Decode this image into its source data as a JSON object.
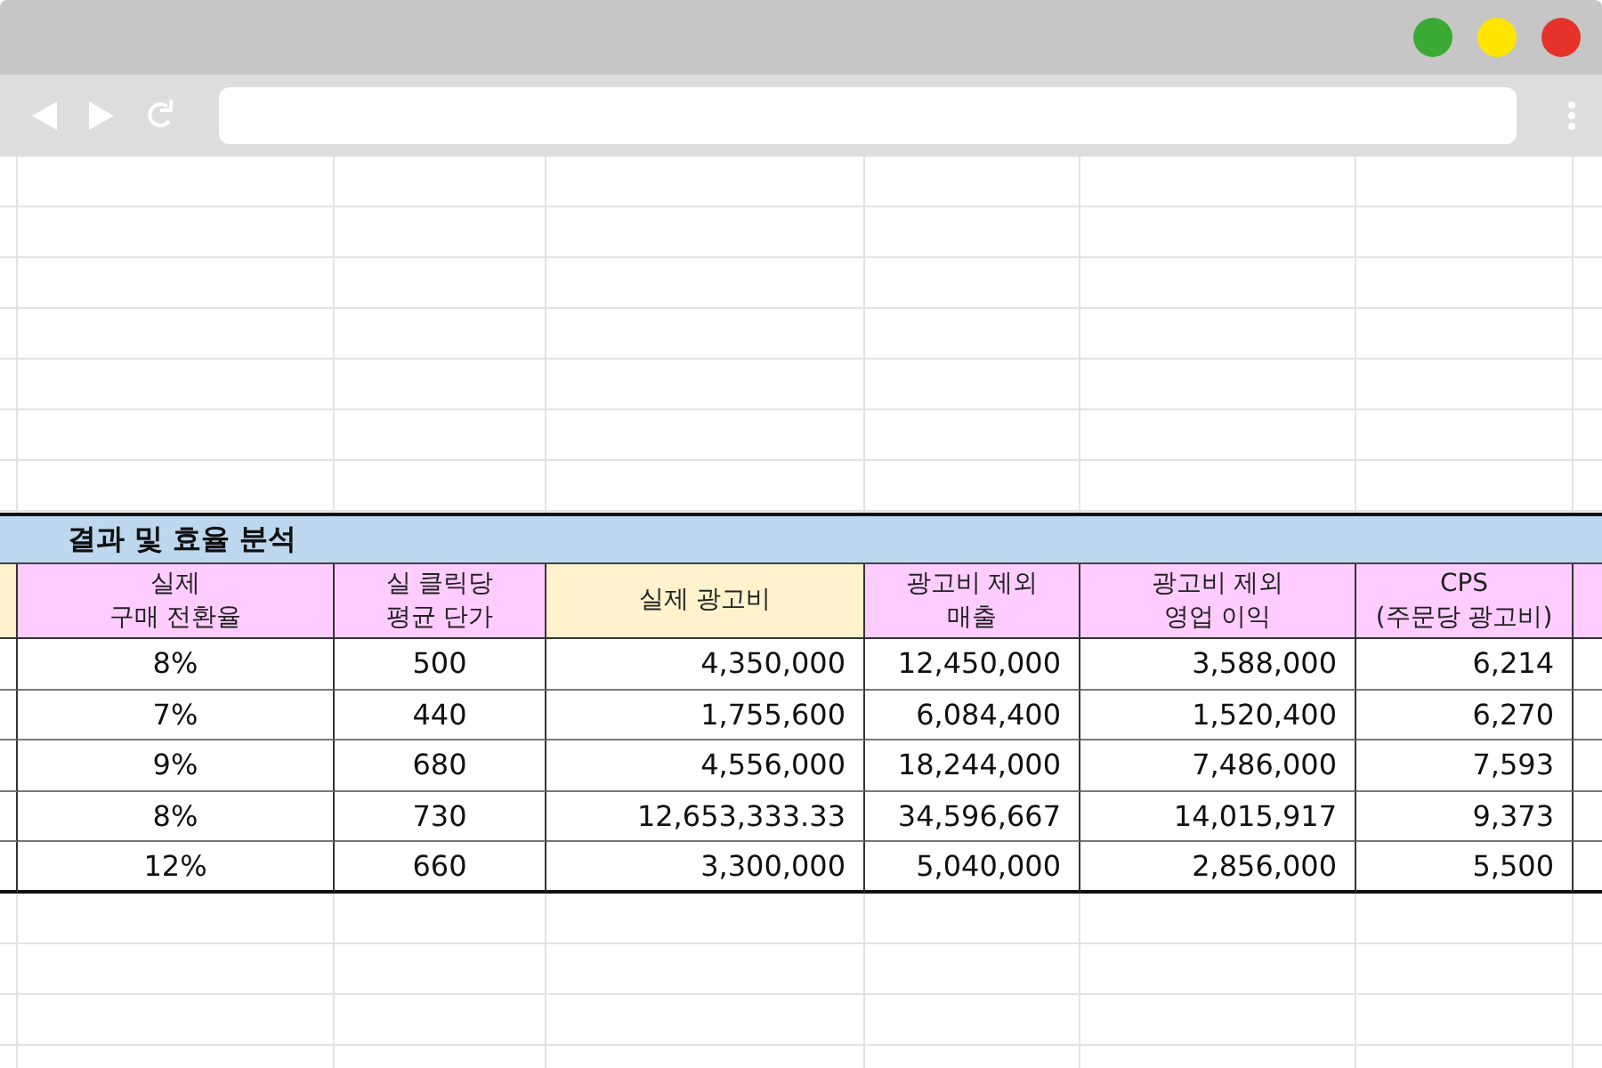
{
  "browser": {
    "window_controls": [
      {
        "color": "#3aaa35"
      },
      {
        "color": "#ffe500"
      },
      {
        "color": "#e5332a"
      }
    ]
  },
  "sheet": {
    "title": "결과 및 효율 분석",
    "columns": [
      {
        "color": "#fff2cc"
      },
      {
        "label": "실제\n구매 전환율",
        "color": "#ffccff",
        "kind": "centered"
      },
      {
        "label": "실 클릭당\n평균 단가",
        "color": "#ffccff",
        "kind": "centered"
      },
      {
        "label": "실제 광고비",
        "color": "#fff2cc",
        "kind": "numeric"
      },
      {
        "label": "광고비 제외\n매출",
        "color": "#ffccff",
        "kind": "numeric"
      },
      {
        "label": "광고비 제외\n영업 이익",
        "color": "#ffccff",
        "kind": "numeric"
      },
      {
        "label": "CPS\n(주문당 광고비)",
        "color": "#ffccff",
        "kind": "numeric"
      },
      {
        "color": "#ffccff"
      }
    ],
    "rows": [
      [
        "",
        "8%",
        "500",
        "4,350,000",
        "12,450,000",
        "3,588,000",
        "6,214",
        ""
      ],
      [
        "",
        "7%",
        "440",
        "1,755,600",
        "6,084,400",
        "1,520,400",
        "6,270",
        ""
      ],
      [
        "",
        "9%",
        "680",
        "4,556,000",
        "18,244,000",
        "7,486,000",
        "7,593",
        ""
      ],
      [
        "",
        "8%",
        "730",
        "12,653,333.33",
        "34,596,667",
        "14,015,917",
        "9,373",
        ""
      ],
      [
        "",
        "12%",
        "660",
        "3,300,000",
        "5,040,000",
        "2,856,000",
        "5,500",
        ""
      ]
    ]
  }
}
